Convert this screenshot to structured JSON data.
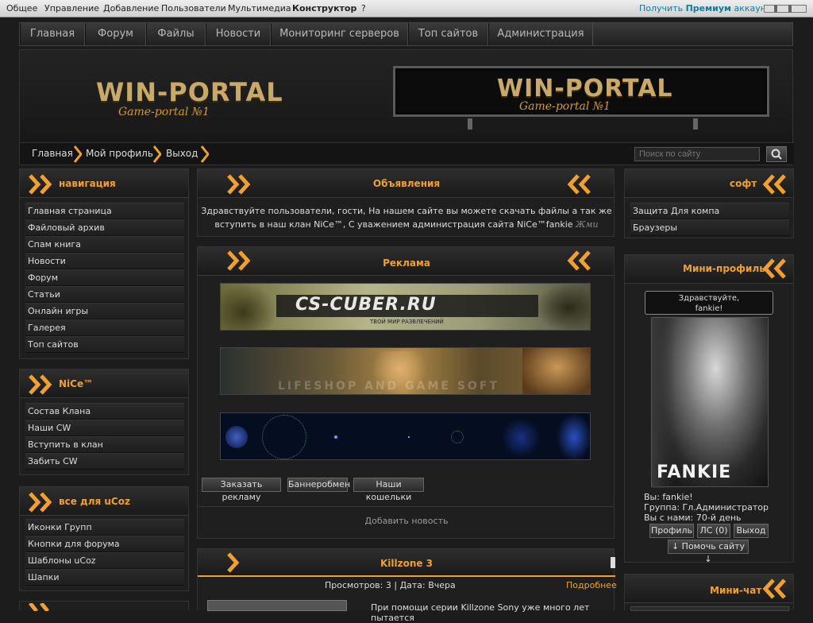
{
  "topbar": {
    "items": [
      "Общее",
      "Управление",
      "Добавление",
      "Пользователи",
      "Мультимедиа",
      "Конструктор",
      "?"
    ],
    "premium_prefix": "Получить",
    "premium_bold": "Премиум",
    "premium_suffix": "аккаунт"
  },
  "nav": [
    "Главная",
    "Форум",
    "Файлы",
    "Новости",
    "Мониторинг серверов",
    "Топ сайтов",
    "Администрация"
  ],
  "logo": {
    "title": "WIN-PORTAL",
    "subtitle": "Game-portal №1"
  },
  "breadcrumb": [
    "Главная",
    "Мой профиль",
    "Выход"
  ],
  "search": {
    "placeholder": "Поиск по сайту"
  },
  "left": {
    "nav_title": "навигация",
    "nav_items": [
      "Главная страница",
      "Файловый архив",
      "Спам книга",
      "Новости",
      "Форум",
      "Статьи",
      "Онлайн игры",
      "Галерея",
      "Топ сайтов"
    ],
    "clan_title": "NiCe™",
    "clan_items": [
      "Состав Клана",
      "Наши CW",
      "Вступить в клан",
      "Забить CW"
    ],
    "ucoz_title": "все для uCoz",
    "ucoz_items": [
      "Иконки Групп",
      "Кнопки для форума",
      "Шаблоны uCoz",
      "Шапки"
    ]
  },
  "center": {
    "announce_title": "Объявления",
    "announce_text": "Здравствуйте пользователи, гости, На нашем сайте вы можете скачать файлы а так же вступить в наш клан NiCe™, С уважением администрация сайта NiCe™fankie",
    "announce_link": "Жми",
    "ads_title": "Реклама",
    "banner1_text": "CS-CUBER.RU",
    "banner1_sub": "ТВОЙ МИР РАЗВЛЕЧЕНИЙ",
    "banner2_text": "LIFESHOP AND GAME SOFT",
    "ad_buttons": [
      "Заказать рекламу",
      "Баннеробмен",
      "Наши кошельки"
    ],
    "add_news": "Добавить новость",
    "news_title": "Killzone 3",
    "news_meta": "Просмотров: 3 | Дата: Вчера",
    "news_more": "Подробнее",
    "news_text": "При помощи серии Killzone Sony уже много лет пытается"
  },
  "right": {
    "soft_title": "софт",
    "soft_items": [
      "Защита Для компа",
      "Браузеры"
    ],
    "profile_title": "Мини-профиль",
    "greeting_line1": "Здравствуйте,",
    "greeting_line2": "fankie!",
    "avatar_name": "FANKIE",
    "you_label": "Вы: fankie!",
    "group_label": "Группа: Гл.Администратор",
    "with_us": "Вы с нами: 70-й день",
    "btn_profile": "Профиль",
    "btn_pm": "ЛС (0)",
    "btn_logout": "Выход",
    "help_btn": "↓ Помочь сайту ↓",
    "chat_title": "Мини-чат"
  },
  "colors": {
    "accent": "#f0a030",
    "bg": "#1c1c1c"
  }
}
